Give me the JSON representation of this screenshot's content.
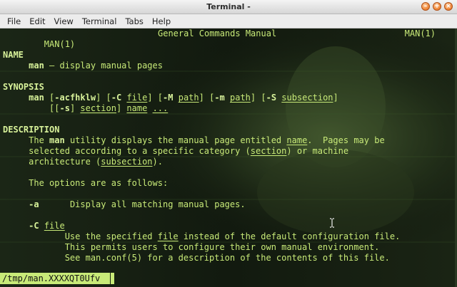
{
  "window": {
    "title": "Terminal -"
  },
  "menu": [
    "File",
    "Edit",
    "View",
    "Terminal",
    "Tabs",
    "Help"
  ],
  "man": {
    "header_left": "MAN(1)",
    "header_center": "General Commands Manual",
    "header_right": "MAN(1)",
    "name_heading": "NAME",
    "name_cmd": "man",
    "name_desc": " – display manual pages",
    "synopsis_heading": "SYNOPSIS",
    "syn_cmd": "man",
    "syn_acfhklw": "-acfhklw",
    "syn_C": "-C",
    "syn_file": "file",
    "syn_M": "-M",
    "syn_path1": "path",
    "syn_m": "-m",
    "syn_path2": "path",
    "syn_S": "-S",
    "syn_subsection": "subsection",
    "syn_s": "-s",
    "syn_section": "section",
    "syn_name": "name",
    "syn_dots": "...",
    "description_heading": "DESCRIPTION",
    "desc1_a": "The ",
    "desc1_man": "man",
    "desc1_b": " utility displays the manual page entitled ",
    "desc1_name": "name",
    "desc1_c": ".  Pages may be",
    "desc2_a": "selected according to a specific category (",
    "desc2_section": "section",
    "desc2_b": ") or machine",
    "desc3_a": "architecture (",
    "desc3_subsection": "subsection",
    "desc3_b": ").",
    "options_intro": "The options are as follows:",
    "opt_a_flag": "-a",
    "opt_a_desc": "Display all matching manual pages.",
    "opt_C_flag": "-C",
    "opt_C_arg": "file",
    "optC1_a": "Use the specified ",
    "optC1_file": "file",
    "optC1_b": " instead of the default configuration file.",
    "optC2": "This permits users to configure their own manual environment.",
    "optC3": "See man.conf(5) for a description of the contents of this file."
  },
  "status": {
    "path": "/tmp/man.XXXXQT0Ufv"
  }
}
